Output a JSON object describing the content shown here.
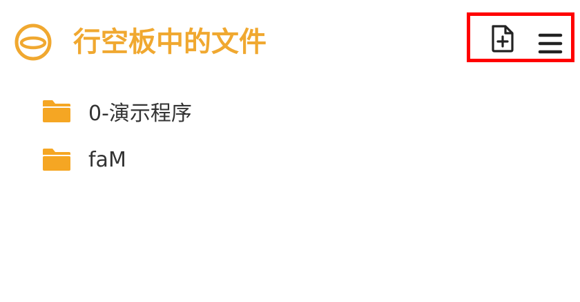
{
  "header": {
    "title": "行空板中的文件",
    "logo_icon": "ring-logo-icon",
    "actions": [
      {
        "name": "new-file",
        "icon": "file-plus-icon"
      },
      {
        "name": "menu",
        "icon": "hamburger-menu-icon"
      }
    ]
  },
  "files": [
    {
      "label": "0-演示程序",
      "icon": "folder-icon"
    },
    {
      "label": "faM",
      "icon": "folder-icon"
    }
  ],
  "colors": {
    "accent": "#f0a830",
    "folder": "#f5a623",
    "icon": "#222222",
    "highlight": "#ff0000",
    "text": "#333333"
  }
}
